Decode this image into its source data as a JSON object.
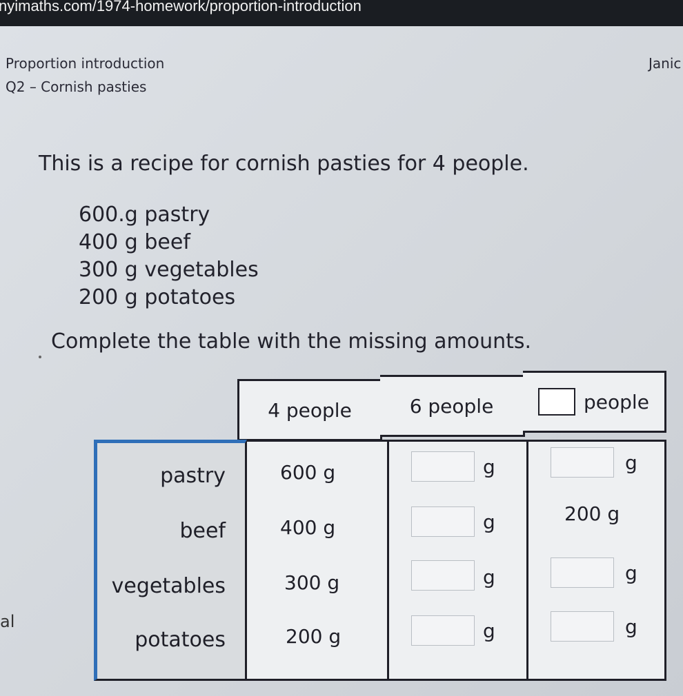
{
  "browser": {
    "url": "nyimaths.com/1974-homework/proportion-introduction"
  },
  "header": {
    "lesson_title": "Proportion introduction",
    "user_name": "Janic",
    "question_label": "Q2 – Cornish pasties"
  },
  "question": {
    "intro": "This is a recipe for cornish pasties for 4 people.",
    "ingredients": [
      "600.g pastry",
      "400 g beef",
      "300 g vegetables",
      "200 g potatoes"
    ],
    "instruction": "Complete the table with the missing amounts."
  },
  "table": {
    "headers": [
      "4 people",
      "6 people",
      "people"
    ],
    "rows": [
      {
        "label": "pastry",
        "four": "600 g",
        "six_unit": "g",
        "custom": "",
        "custom_unit": "g"
      },
      {
        "label": "beef",
        "four": "400 g",
        "six_unit": "g",
        "custom": "200 g",
        "custom_unit": ""
      },
      {
        "label": "vegetables",
        "four": "300 g",
        "six_unit": "g",
        "custom": "",
        "custom_unit": "g"
      },
      {
        "label": "potatoes",
        "four": "200 g",
        "six_unit": "g",
        "custom": "",
        "custom_unit": "g"
      }
    ]
  },
  "sidebar_fragments": {
    "mark_1": "al"
  }
}
